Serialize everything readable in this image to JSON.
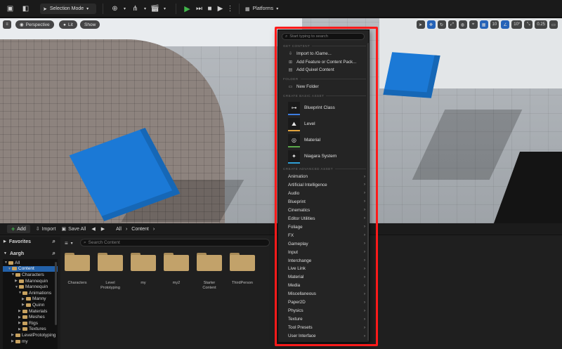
{
  "toolbar": {
    "mode_label": "Selection Mode",
    "platforms_label": "Platforms",
    "accent_play": "#41b54b"
  },
  "viewport": {
    "perspective_label": "Perspective",
    "lit_label": "Lit",
    "show_label": "Show",
    "grid_snap_value": "10",
    "rotation_snap_value": "10°",
    "scale_snap_value": "0.25"
  },
  "add_menu": {
    "search_placeholder": "Start typing to search",
    "sections": {
      "get_content": "GET CONTENT",
      "folder": "FOLDER",
      "create_basic": "CREATE BASIC ASSET",
      "create_advanced": "CREATE ADVANCED ASSET"
    },
    "get_content_items": [
      {
        "label": "Import to /Game...",
        "icon": "import-icon"
      },
      {
        "label": "Add Feature or Content Pack...",
        "icon": "pack-icon"
      },
      {
        "label": "Add Quixel Content",
        "icon": "quixel-icon"
      }
    ],
    "folder_items": [
      {
        "label": "New Folder",
        "icon": "new-folder-icon"
      }
    ],
    "basic_assets": [
      {
        "label": "Blueprint Class",
        "icon": "blueprint-class-icon",
        "color": "#3d7de0"
      },
      {
        "label": "Level",
        "icon": "level-icon",
        "color": "#e0a23d"
      },
      {
        "label": "Material",
        "icon": "material-icon",
        "color": "#5aa84a"
      },
      {
        "label": "Niagara System",
        "icon": "niagara-icon",
        "color": "#2f9fd6"
      }
    ],
    "advanced_assets": [
      "Animation",
      "Artificial Intelligence",
      "Audio",
      "Blueprint",
      "Cinematics",
      "Editor Utilities",
      "Foliage",
      "FX",
      "Gameplay",
      "Input",
      "Interchange",
      "Live Link",
      "Material",
      "Media",
      "Miscellaneous",
      "Paper2D",
      "Physics",
      "Texture",
      "Tool Presets",
      "User Interface"
    ],
    "highlight_color": "#ff1a1a"
  },
  "content_browser": {
    "add_label": "Add",
    "import_label": "Import",
    "save_all_label": "Save All",
    "breadcrumb": [
      "All",
      "Content"
    ],
    "favorites_label": "Favorites",
    "project_label": "Aargh",
    "search_placeholder": "Search Content",
    "tree": [
      {
        "label": "All",
        "depth": 0,
        "expanded": true,
        "selected": false
      },
      {
        "label": "Content",
        "depth": 1,
        "expanded": true,
        "selected": true
      },
      {
        "label": "Characters",
        "depth": 2,
        "expanded": true,
        "selected": false
      },
      {
        "label": "Mannequin",
        "depth": 3,
        "expanded": false,
        "selected": false
      },
      {
        "label": "Mannequin",
        "depth": 3,
        "expanded": true,
        "selected": false
      },
      {
        "label": "Animations",
        "depth": 4,
        "expanded": true,
        "selected": false
      },
      {
        "label": "Manny",
        "depth": 5,
        "expanded": false,
        "selected": false
      },
      {
        "label": "Quinn",
        "depth": 5,
        "expanded": false,
        "selected": false
      },
      {
        "label": "Materials",
        "depth": 4,
        "expanded": false,
        "selected": false
      },
      {
        "label": "Meshes",
        "depth": 4,
        "expanded": false,
        "selected": false
      },
      {
        "label": "Rigs",
        "depth": 4,
        "expanded": false,
        "selected": false
      },
      {
        "label": "Textures",
        "depth": 4,
        "expanded": false,
        "selected": false
      },
      {
        "label": "LevelPrototyping",
        "depth": 2,
        "expanded": false,
        "selected": false
      },
      {
        "label": "my",
        "depth": 2,
        "expanded": false,
        "selected": false
      }
    ],
    "assets": [
      "Characters",
      "Level Prototyping",
      "my",
      "my2",
      "Starter Content",
      "ThirdPerson"
    ]
  }
}
